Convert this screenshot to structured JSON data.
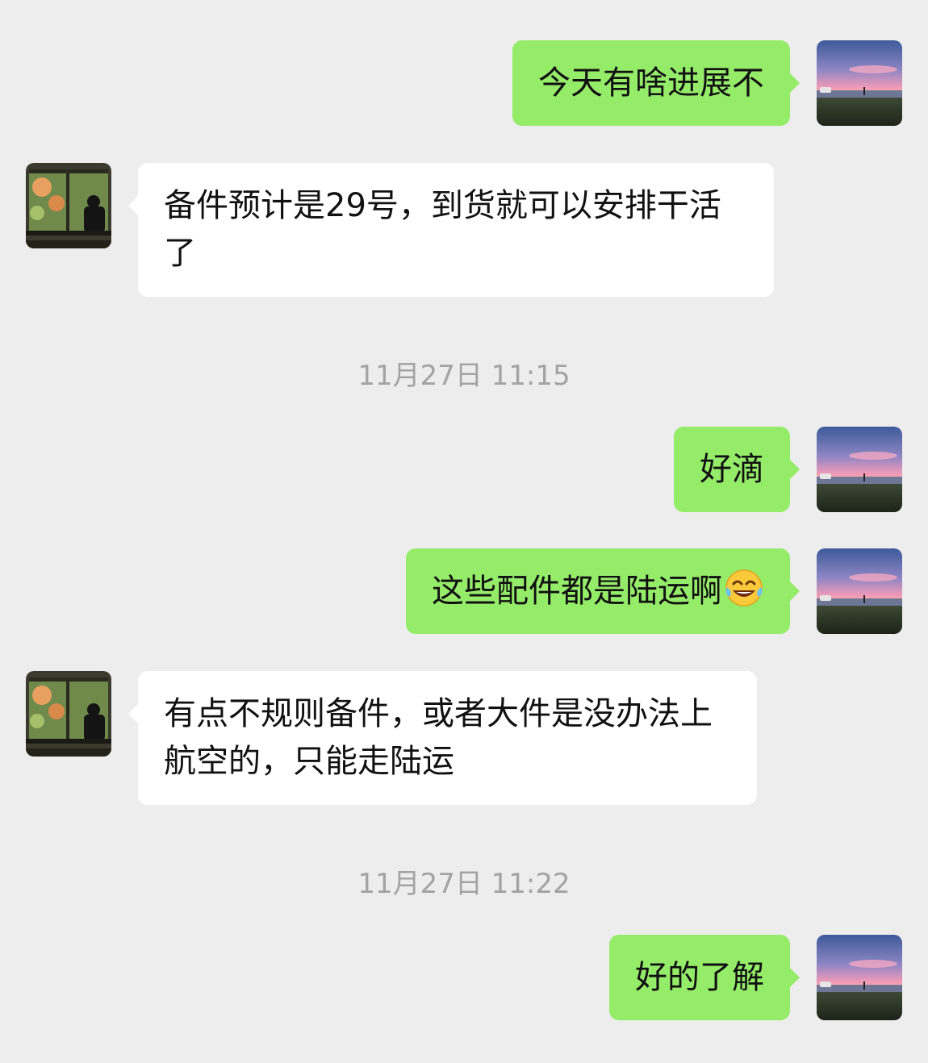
{
  "messages": [
    {
      "sender": "me",
      "text": "今天有啥进展不"
    },
    {
      "sender": "them",
      "text": "备件预计是29号，到货就可以安排干活了"
    },
    {
      "type": "timestamp",
      "text": "11月27日 11:15"
    },
    {
      "sender": "me",
      "text": "好滴"
    },
    {
      "sender": "me",
      "text": "这些配件都是陆运啊",
      "emoji": "tears-of-joy-emoji"
    },
    {
      "sender": "them",
      "text": "有点不规则备件，或者大件是没办法上航空的，只能走陆运"
    },
    {
      "type": "timestamp",
      "text": "11月27日 11:22"
    },
    {
      "sender": "me",
      "text": "好的了解"
    }
  ],
  "colors": {
    "background": "#ededed",
    "my_bubble": "#95ec69",
    "their_bubble": "#ffffff",
    "timestamp_text": "#a3a3a3"
  }
}
